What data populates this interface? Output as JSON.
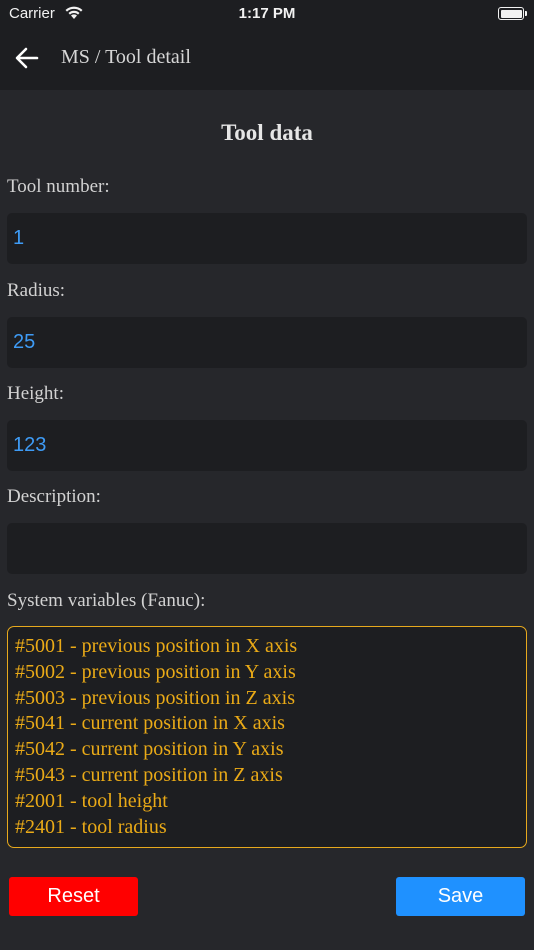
{
  "status_bar": {
    "carrier": "Carrier",
    "time": "1:17 PM"
  },
  "header": {
    "title": "MS / Tool detail",
    "back_icon": "arrow-left-icon"
  },
  "form": {
    "section_title": "Tool data",
    "tool_number": {
      "label": "Tool number:",
      "value": "1"
    },
    "radius": {
      "label": "Radius:",
      "value": "25"
    },
    "height": {
      "label": "Height:",
      "value": "123"
    },
    "description": {
      "label": "Description:",
      "value": ""
    }
  },
  "system_variables": {
    "label": "System variables (Fanuc):",
    "lines": [
      "#5001 - previous position in X axis",
      "#5002 - previous position in Y axis",
      "#5003 - previous position in Z axis",
      "#5041 - current position in X axis",
      "#5042 - current position in Y axis",
      "#5043 - current position in Z axis",
      "#2001 - tool height",
      "#2401 - tool radius"
    ]
  },
  "buttons": {
    "reset_label": "Reset",
    "save_label": "Save"
  },
  "colors": {
    "background": "#26272b",
    "field_background": "#1d1e21",
    "value_text": "#3e9bf5",
    "sysvar_accent": "#eaaa17",
    "reset": "#ff0000",
    "save": "#1f91ff"
  }
}
